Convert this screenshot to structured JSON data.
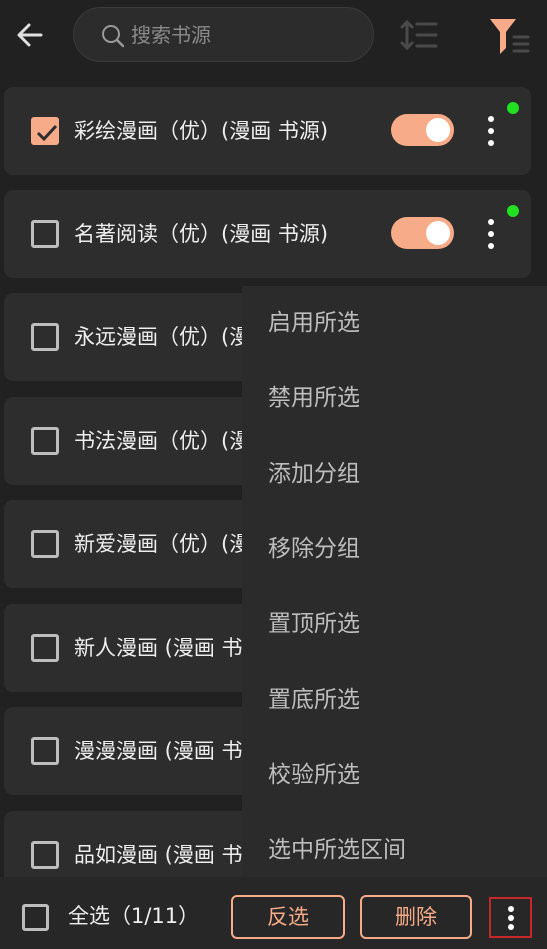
{
  "header": {
    "search_placeholder": "搜索书源"
  },
  "sources": [
    {
      "name": "彩绘漫画（优）(漫画 书源)",
      "checked": true,
      "enabled": true,
      "status_dot": true
    },
    {
      "name": "名著阅读（优）(漫画 书源)",
      "checked": false,
      "enabled": true,
      "status_dot": true
    },
    {
      "name": "永远漫画（优）(漫画 书源)",
      "checked": false
    },
    {
      "name": "书法漫画（优）(漫画 书源)",
      "checked": false
    },
    {
      "name": "新爱漫画（优）(漫画 书源)",
      "checked": false
    },
    {
      "name": "新人漫画 (漫画 书源)",
      "checked": false
    },
    {
      "name": "漫漫漫画 (漫画 书源)",
      "checked": false
    },
    {
      "name": "品如漫画 (漫画 书源)",
      "checked": false
    }
  ],
  "menu": {
    "items": [
      "启用所选",
      "禁用所选",
      "添加分组",
      "移除分组",
      "置顶所选",
      "置底所选",
      "校验所选",
      "选中所选区间"
    ]
  },
  "bottom": {
    "select_all": "全选（1/11）",
    "invert": "反选",
    "delete": "删除"
  },
  "colors": {
    "accent": "#f7ab88",
    "background": "#212121",
    "card": "#2d2d2d",
    "status_dot": "#22e022",
    "highlight_border": "#c62828"
  }
}
